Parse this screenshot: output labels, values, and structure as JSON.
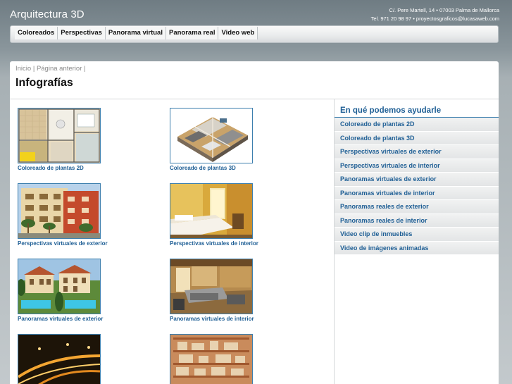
{
  "header": {
    "site_title": "Arquitectura 3D",
    "address": "C/. Pere Martell, 14 • 07003 Palma de Mallorca",
    "phone_email": "Tel. 971 20 98 97 • proyectosgraficos@lucasaweb.com"
  },
  "nav": {
    "items": [
      "Coloreados",
      "Perspectivas",
      "Panorama virtual",
      "Panorama real",
      "Video web"
    ]
  },
  "breadcrumb": {
    "home": "Inicio",
    "sep1": "|",
    "previous": "Página anterior",
    "sep2": "|"
  },
  "main": {
    "title": "Infografías",
    "tiles": [
      {
        "caption": "Coloreado de plantas 2D",
        "image": "floor-plan-2d"
      },
      {
        "caption": "Coloreado de plantas 3D",
        "image": "floor-plan-3d"
      },
      {
        "caption": "Perspectivas virtuales de exterior",
        "image": "building-exterior"
      },
      {
        "caption": "Perspectivas virtuales de interior",
        "image": "bedroom-interior"
      },
      {
        "caption": "Panoramas virtuales de exterior",
        "image": "houses-pool"
      },
      {
        "caption": "Panoramas virtuales de interior",
        "image": "living-room"
      },
      {
        "caption": "",
        "image": "night-road"
      },
      {
        "caption": "",
        "image": "shelves-interior"
      }
    ]
  },
  "sidebar": {
    "title": "En qué podemos ayudarle",
    "items": [
      "Coloreado de plantas 2D",
      "Coloreado de plantas 3D",
      "Perspectivas virtuales de exterior",
      "Perspectivas virtuales de interior",
      "Panoramas virtuales de exterior",
      "Panoramas virtuales de interior",
      "Panoramas reales de exterior",
      "Panoramas reales de interior",
      "Video clip de inmuebles",
      "Video de imágenes animadas"
    ]
  },
  "colors": {
    "link": "#1f5f95",
    "thumb_border": "#3d7fae",
    "background_top": "#6f7c83"
  }
}
